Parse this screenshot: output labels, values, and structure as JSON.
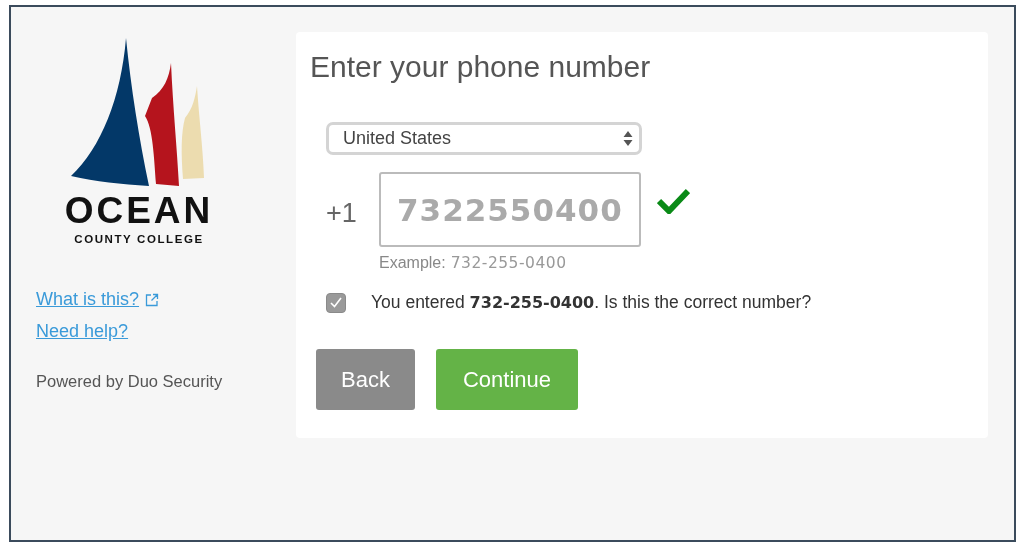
{
  "logo": {
    "name": "OCEAN",
    "subtitle": "COUNTY COLLEGE"
  },
  "links": [
    {
      "label": "What is this?",
      "external": true
    },
    {
      "label": "Need help?",
      "external": false
    }
  ],
  "footer": "Powered by Duo Security",
  "prompt": {
    "title": "Enter your phone number",
    "country": "United States",
    "country_code": "+1",
    "phone": "7322550400",
    "valid": true,
    "example_label": "Example:",
    "example_number": "732-255-0400",
    "confirm": {
      "checked": true,
      "text": "You entered **732-255-0400**. Is this the correct number?"
    },
    "buttons": [
      {
        "label": "Back",
        "kind": "secondary"
      },
      {
        "label": "Continue",
        "kind": "primary"
      }
    ]
  }
}
